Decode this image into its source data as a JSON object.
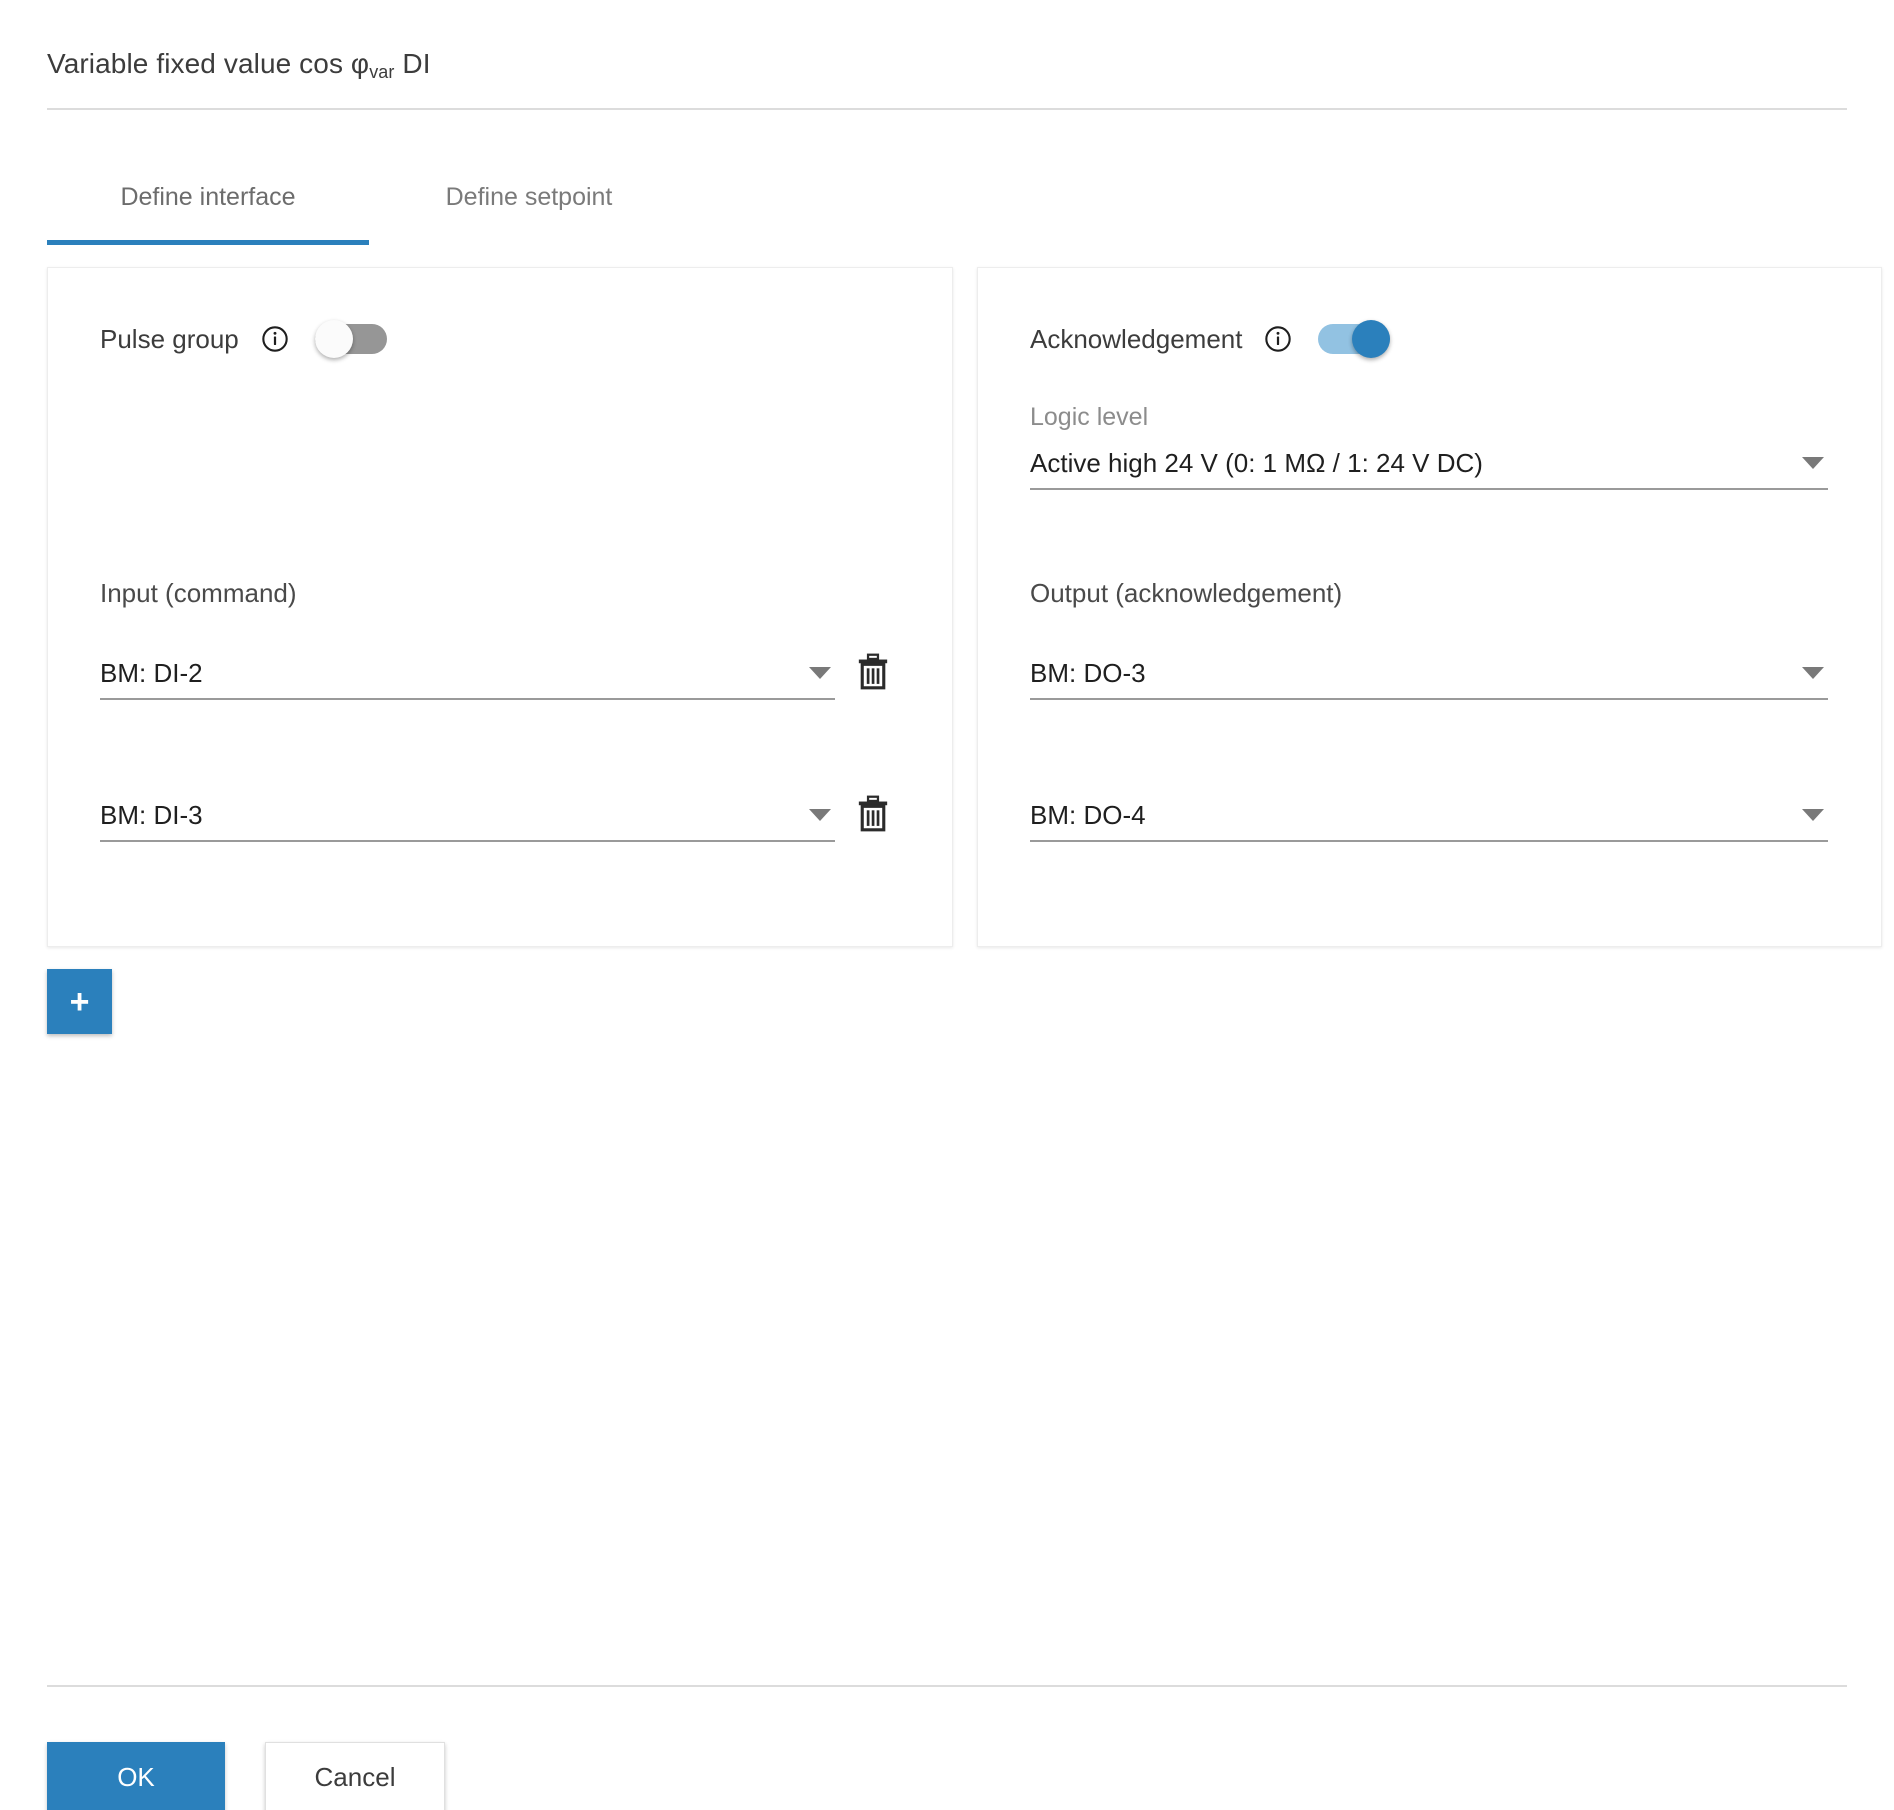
{
  "dialog": {
    "title_prefix": "Variable fixed value cos φ",
    "title_sub": "var",
    "title_suffix": " DI",
    "title_full": "Variable fixed value cos φvar DI"
  },
  "tabs": [
    {
      "label": "Define interface",
      "active": true
    },
    {
      "label": "Define setpoint",
      "active": false
    }
  ],
  "left_panel": {
    "toggle": {
      "label": "Pulse group",
      "info_icon": "info-circle-icon",
      "state": "off"
    },
    "section_label": "Input (command)",
    "fields": [
      {
        "value": "BM: DI-2",
        "caret_icon": "chevron-down-icon",
        "delete_icon": "trash-icon"
      },
      {
        "value": "BM: DI-3",
        "caret_icon": "chevron-down-icon",
        "delete_icon": "trash-icon"
      }
    ]
  },
  "right_panel": {
    "toggle": {
      "label": "Acknowledgement",
      "info_icon": "info-circle-icon",
      "state": "on"
    },
    "logic_level": {
      "label": "Logic level",
      "value": "Active high 24 V (0: 1 MΩ / 1: 24 V DC)",
      "caret_icon": "chevron-down-icon"
    },
    "section_label": "Output (acknowledgement)",
    "fields": [
      {
        "value": "BM: DO-3",
        "caret_icon": "chevron-down-icon"
      },
      {
        "value": "BM: DO-4",
        "caret_icon": "chevron-down-icon"
      }
    ]
  },
  "add_button": {
    "label": "+",
    "icon": "plus-icon"
  },
  "footer": {
    "ok_label": "OK",
    "cancel_label": "Cancel"
  },
  "colors": {
    "accent": "#2b80bc",
    "toggle_off_track": "#969696",
    "toggle_on_track": "#92c2e2",
    "rule": "#dcdcdc",
    "field_underline": "#9a9a9a",
    "label_muted": "#8c8c8c"
  }
}
